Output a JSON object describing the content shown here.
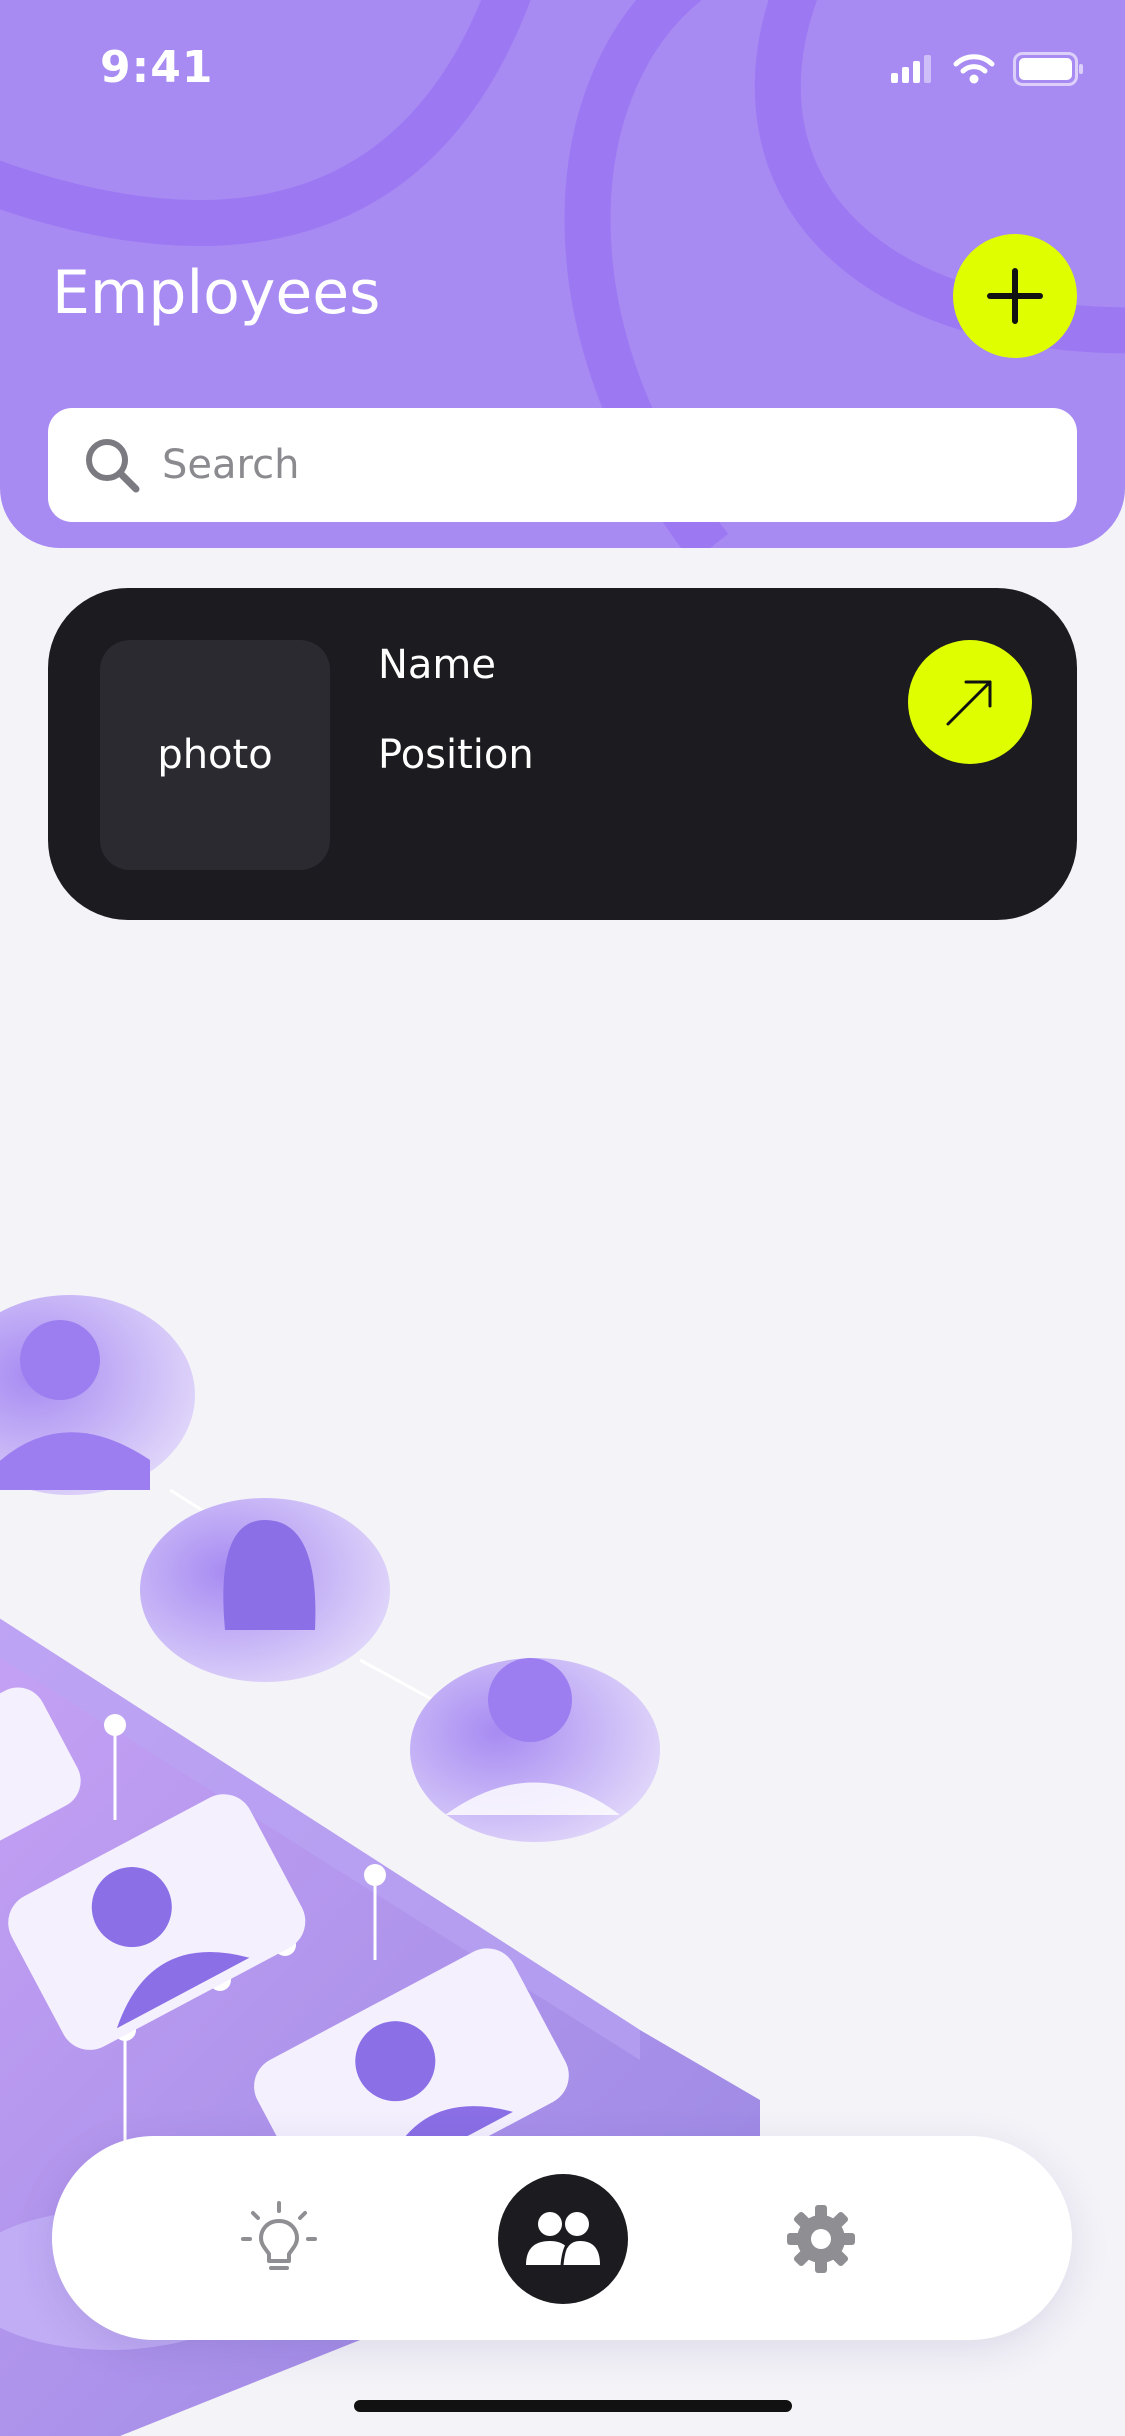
{
  "status_bar": {
    "time": "9:41",
    "icons": [
      "cellular-signal-icon",
      "wifi-icon",
      "battery-icon"
    ]
  },
  "header": {
    "title": "Employees",
    "add_button_icon": "plus-icon"
  },
  "search": {
    "placeholder": "Search",
    "value": "",
    "icon": "search-icon"
  },
  "employee_card": {
    "photo_label": "photo",
    "name": "Name",
    "position": "Position",
    "open_button_icon": "arrow-up-right-icon"
  },
  "bottom_nav": {
    "items": [
      {
        "icon": "lightbulb-icon",
        "active": false
      },
      {
        "icon": "people-icon",
        "active": true
      },
      {
        "icon": "gear-icon",
        "active": false
      }
    ]
  },
  "colors": {
    "header_bg": "#a78bf2",
    "accent": "#dfff00",
    "card_bg": "#1b1b20",
    "page_bg": "#f4f3f8"
  }
}
